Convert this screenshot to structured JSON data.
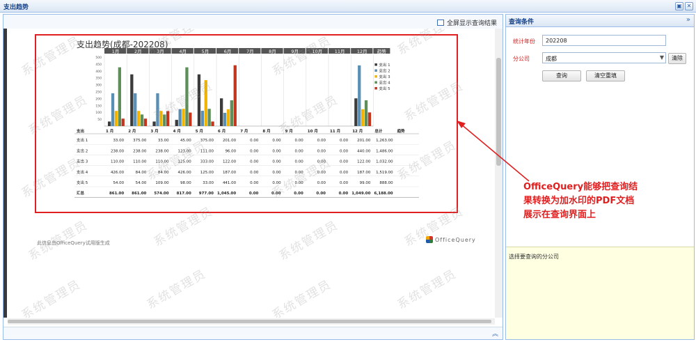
{
  "window": {
    "title": "支出趋势"
  },
  "toolbar": {
    "fullscreen_label": "全屏显示查询结果"
  },
  "query_panel": {
    "title": "查询条件",
    "year_label": "统计年份",
    "year_value": "202208",
    "branch_label": "分公司",
    "branch_value": "成都",
    "clear_label": "清除",
    "query_label": "查询",
    "reset_label": "清空重填",
    "hint": "选择要查询的分公司"
  },
  "report": {
    "title": "支出趋势(成都-202208)",
    "notice": "此信息由OfficeQuery试用版生成",
    "logo_text": "OfficeQuery",
    "watermark": "系统管理员"
  },
  "callout": {
    "lines": [
      "OfficeQuery能够把查询结",
      "果转换为加水印的PDF文档",
      "展示在查询界面上"
    ]
  },
  "chart_data": {
    "type": "bar",
    "title": "支出趋势(成都-202208)",
    "categories": [
      "1月",
      "2月",
      "3月",
      "4月",
      "5月",
      "6月",
      "7月",
      "8月",
      "9月",
      "10月",
      "11月",
      "12月"
    ],
    "header_extra": "趋势",
    "ylim": [
      0,
      500
    ],
    "yticks": [
      0,
      50,
      100,
      150,
      200,
      250,
      300,
      350,
      400,
      450,
      500
    ],
    "legend_position": "right",
    "series": [
      {
        "name": "支出 1",
        "color": "#3b3b3b",
        "values": [
          33,
          375,
          33,
          45,
          375,
          201,
          0,
          0,
          0,
          0,
          0,
          201
        ]
      },
      {
        "name": "支出 2",
        "color": "#5a8fb4",
        "values": [
          238,
          238,
          238,
          123,
          111,
          96,
          0,
          0,
          0,
          0,
          0,
          440
        ]
      },
      {
        "name": "支出 3",
        "color": "#f2b400",
        "values": [
          110,
          110,
          110,
          125,
          333,
          122,
          0,
          0,
          0,
          0,
          0,
          122
        ]
      },
      {
        "name": "支出 4",
        "color": "#5e8f5a",
        "values": [
          426,
          84,
          84,
          426,
          125,
          187,
          0,
          0,
          0,
          0,
          0,
          187
        ]
      },
      {
        "name": "支出 5",
        "color": "#c1351d",
        "values": [
          54,
          54,
          109,
          98,
          33,
          441,
          0,
          0,
          0,
          0,
          0,
          99
        ]
      }
    ],
    "table": {
      "corner": "支出",
      "columns": [
        "1 月",
        "2 月",
        "3 月",
        "4 月",
        "5 月",
        "6 月",
        "7 月",
        "8 月",
        "9 月",
        "10 月",
        "11 月",
        "12 月",
        "总计",
        "趋势"
      ],
      "rows": [
        {
          "label": "支出 1",
          "cells": [
            "33.00",
            "375.00",
            "33.00",
            "45.00",
            "375.00",
            "201.00",
            "0.00",
            "0.00",
            "0.00",
            "0.00",
            "0.00",
            "201.00",
            "1,263.00",
            ""
          ]
        },
        {
          "label": "支出 2",
          "cells": [
            "238.00",
            "238.00",
            "238.00",
            "123.00",
            "111.00",
            "96.00",
            "0.00",
            "0.00",
            "0.00",
            "0.00",
            "0.00",
            "440.00",
            "1,486.00",
            ""
          ]
        },
        {
          "label": "支出 3",
          "cells": [
            "110.00",
            "110.00",
            "110.00",
            "125.00",
            "333.00",
            "122.00",
            "0.00",
            "0.00",
            "0.00",
            "0.00",
            "0.00",
            "122.00",
            "1,032.00",
            ""
          ]
        },
        {
          "label": "支出 4",
          "cells": [
            "426.00",
            "84.00",
            "84.00",
            "426.00",
            "125.00",
            "187.00",
            "0.00",
            "0.00",
            "0.00",
            "0.00",
            "0.00",
            "187.00",
            "1,519.00",
            ""
          ]
        },
        {
          "label": "支出 5",
          "cells": [
            "54.00",
            "54.00",
            "109.00",
            "98.00",
            "33.00",
            "441.00",
            "0.00",
            "0.00",
            "0.00",
            "0.00",
            "0.00",
            "99.00",
            "888.00",
            ""
          ]
        },
        {
          "label": "汇总",
          "cells": [
            "861.00",
            "861.00",
            "574.00",
            "817.00",
            "977.00",
            "1,045.00",
            "0.00",
            "0.00",
            "0.00",
            "0.00",
            "0.00",
            "1,049.00",
            "6,188.00",
            ""
          ]
        }
      ]
    }
  }
}
